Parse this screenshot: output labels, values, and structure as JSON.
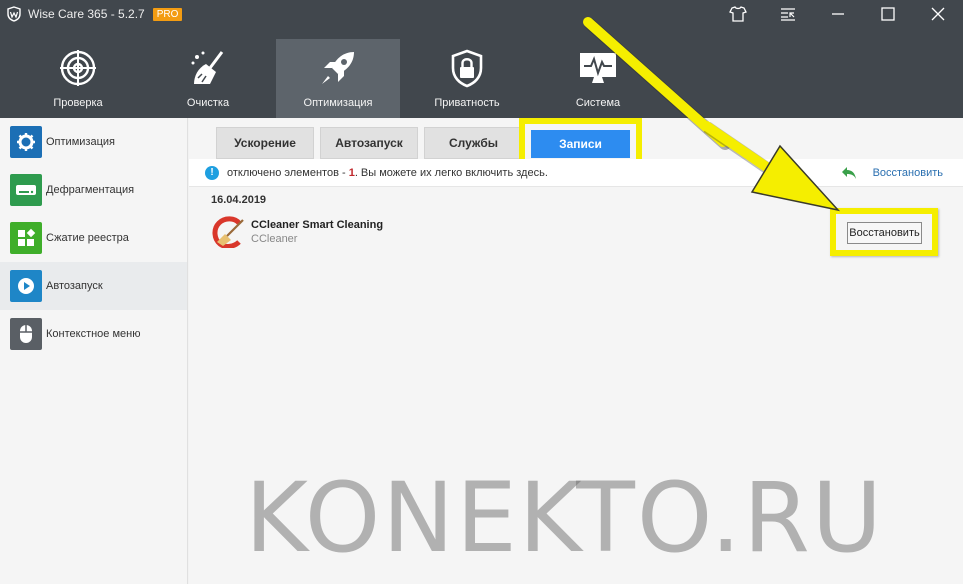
{
  "window": {
    "title": "Wise Care 365 - 5.2.7",
    "badge": "PRO"
  },
  "toolbar": {
    "items": [
      {
        "label": "Проверка",
        "icon": "radar-icon"
      },
      {
        "label": "Очистка",
        "icon": "broom-icon"
      },
      {
        "label": "Оптимизация",
        "icon": "rocket-icon",
        "active": true
      },
      {
        "label": "Приватность",
        "icon": "lock-shield-icon"
      },
      {
        "label": "Система",
        "icon": "monitor-pulse-icon"
      }
    ]
  },
  "sidebar": {
    "items": [
      {
        "label": "Оптимизация",
        "icon": "gear-icon",
        "color": "#1c6fb5"
      },
      {
        "label": "Дефрагментация",
        "icon": "disk-icon",
        "color": "#2e9b4e"
      },
      {
        "label": "Сжатие реестра",
        "icon": "blocks-icon",
        "color": "#3fae2a"
      },
      {
        "label": "Автозапуск",
        "icon": "play-icon",
        "color": "#1e86c7",
        "active": true
      },
      {
        "label": "Контекстное меню",
        "icon": "mouse-icon",
        "color": "#5a5f65"
      }
    ]
  },
  "tabs": [
    {
      "label": "Ускорение"
    },
    {
      "label": "Автозапуск"
    },
    {
      "label": "Службы"
    },
    {
      "label": "Записи",
      "active": true
    }
  ],
  "info": {
    "text_before": "отключено элементов - ",
    "count": "1",
    "text_after": ". Вы можете их легко включить здесь.",
    "restore_all": "Восстановить"
  },
  "entry": {
    "date": "16.04.2019",
    "name": "CCleaner Smart Cleaning",
    "publisher": "CCleaner",
    "restore_button": "Восстановить"
  },
  "watermark": "KONEKTO.RU",
  "colors": {
    "accent": "#2d8cf0",
    "highlight": "#f5ee00",
    "titlebar": "#41474d"
  }
}
